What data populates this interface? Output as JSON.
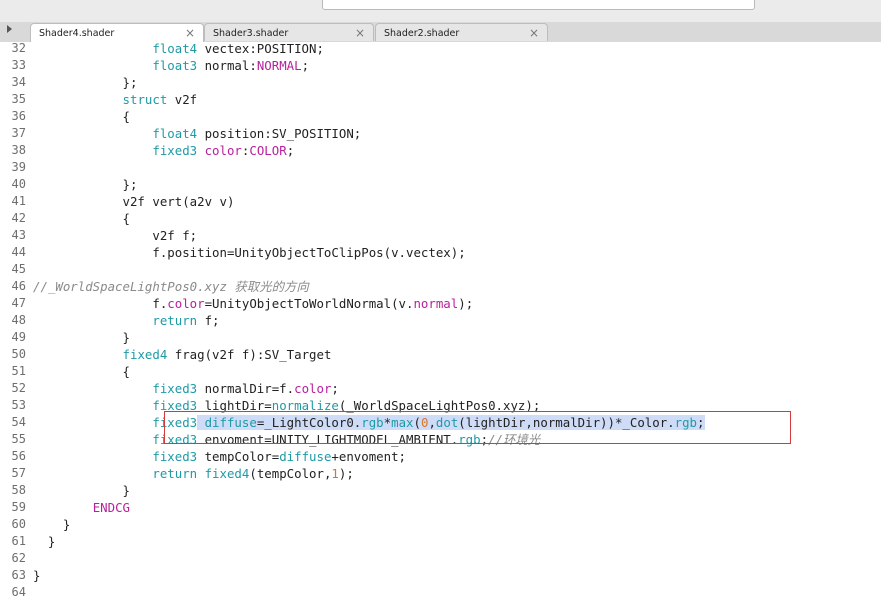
{
  "tabs": [
    {
      "label": "Shader4.shader",
      "close": "×",
      "active": true
    },
    {
      "label": "Shader3.shader",
      "close": "×",
      "active": false
    },
    {
      "label": "Shader2.shader",
      "close": "×",
      "active": false
    }
  ],
  "lines": [
    {
      "n": "32",
      "t": [
        {
          "s": "                float4 ",
          "c": "kw"
        },
        {
          "s": "vectex:",
          "c": ""
        },
        {
          "s": "POSITION",
          "c": ""
        },
        {
          "s": ";",
          "c": ""
        }
      ]
    },
    {
      "n": "33",
      "t": [
        {
          "s": "                ",
          "c": ""
        },
        {
          "s": "float3",
          "c": "kw"
        },
        {
          "s": " normal:",
          "c": ""
        },
        {
          "s": "NORMAL",
          "c": "sem"
        },
        {
          "s": ";",
          "c": ""
        }
      ]
    },
    {
      "n": "34",
      "t": [
        {
          "s": "            };",
          "c": ""
        }
      ]
    },
    {
      "n": "35",
      "t": [
        {
          "s": "            ",
          "c": ""
        },
        {
          "s": "struct",
          "c": "kw"
        },
        {
          "s": " v2f",
          "c": ""
        }
      ]
    },
    {
      "n": "36",
      "t": [
        {
          "s": "            {",
          "c": ""
        }
      ]
    },
    {
      "n": "37",
      "t": [
        {
          "s": "                ",
          "c": ""
        },
        {
          "s": "float4",
          "c": "kw"
        },
        {
          "s": " position:SV_POSITION;",
          "c": ""
        }
      ]
    },
    {
      "n": "38",
      "t": [
        {
          "s": "                ",
          "c": ""
        },
        {
          "s": "fixed3",
          "c": "kw"
        },
        {
          "s": " ",
          "c": ""
        },
        {
          "s": "color",
          "c": "sem"
        },
        {
          "s": ":",
          "c": ""
        },
        {
          "s": "COLOR",
          "c": "sem"
        },
        {
          "s": ";",
          "c": ""
        }
      ]
    },
    {
      "n": "39",
      "t": [
        {
          "s": "",
          "c": ""
        }
      ]
    },
    {
      "n": "40",
      "t": [
        {
          "s": "            };",
          "c": ""
        }
      ]
    },
    {
      "n": "41",
      "t": [
        {
          "s": "            v2f vert(a2v v)",
          "c": ""
        }
      ]
    },
    {
      "n": "42",
      "t": [
        {
          "s": "            {",
          "c": ""
        }
      ]
    },
    {
      "n": "43",
      "t": [
        {
          "s": "                v2f f;",
          "c": ""
        }
      ]
    },
    {
      "n": "44",
      "t": [
        {
          "s": "                f.position=UnityObjectToClipPos(v.vectex);",
          "c": ""
        }
      ]
    },
    {
      "n": "45",
      "t": [
        {
          "s": "",
          "c": ""
        }
      ]
    },
    {
      "n": "46",
      "t": [
        {
          "s": "//_WorldSpaceLightPos0.xyz 获取光的方向",
          "c": "cm"
        }
      ],
      "nocode_indent": true
    },
    {
      "n": "47",
      "t": [
        {
          "s": "                f.",
          "c": ""
        },
        {
          "s": "color",
          "c": "sem"
        },
        {
          "s": "=UnityObjectToWorldNormal(v.",
          "c": ""
        },
        {
          "s": "normal",
          "c": "sem"
        },
        {
          "s": ");",
          "c": ""
        }
      ]
    },
    {
      "n": "48",
      "t": [
        {
          "s": "                ",
          "c": ""
        },
        {
          "s": "return",
          "c": "kw"
        },
        {
          "s": " f;",
          "c": ""
        }
      ]
    },
    {
      "n": "49",
      "t": [
        {
          "s": "            }",
          "c": ""
        }
      ]
    },
    {
      "n": "50",
      "t": [
        {
          "s": "            ",
          "c": ""
        },
        {
          "s": "fixed4",
          "c": "kw"
        },
        {
          "s": " frag(v2f f):SV_Target",
          "c": ""
        }
      ]
    },
    {
      "n": "51",
      "t": [
        {
          "s": "            {",
          "c": ""
        }
      ]
    },
    {
      "n": "52",
      "t": [
        {
          "s": "                ",
          "c": ""
        },
        {
          "s": "fixed3",
          "c": "kw"
        },
        {
          "s": " normalDir=f.",
          "c": ""
        },
        {
          "s": "color",
          "c": "sem"
        },
        {
          "s": ";",
          "c": ""
        }
      ]
    },
    {
      "n": "53",
      "t": [
        {
          "s": "                ",
          "c": ""
        },
        {
          "s": "fixed3",
          "c": "kw"
        },
        {
          "s": " lightDir=",
          "c": ""
        },
        {
          "s": "normalize",
          "c": "fn"
        },
        {
          "s": "(_WorldSpaceLightPos0.xyz);",
          "c": ""
        }
      ]
    },
    {
      "n": "54",
      "t": [
        {
          "s": "                ",
          "c": ""
        },
        {
          "s": "fixed3",
          "c": "kw"
        },
        {
          "s": " ",
          "c": "sel"
        },
        {
          "s": "diffuse",
          "c": "sel kw"
        },
        {
          "s": "=_LightColor0.",
          "c": "sel"
        },
        {
          "s": "rgb",
          "c": "sel kw"
        },
        {
          "s": "*",
          "c": "sel"
        },
        {
          "s": "max",
          "c": "sel fn"
        },
        {
          "s": "(",
          "c": "sel"
        },
        {
          "s": "0",
          "c": "sel num"
        },
        {
          "s": ",",
          "c": "sel"
        },
        {
          "s": "dot",
          "c": "sel fn"
        },
        {
          "s": "(lightDir,normalDir))*_Color.",
          "c": "sel"
        },
        {
          "s": "rgb",
          "c": "sel kw"
        },
        {
          "s": ";",
          "c": "sel"
        }
      ]
    },
    {
      "n": "55",
      "t": [
        {
          "s": "                ",
          "c": ""
        },
        {
          "s": "fixed3",
          "c": "kw"
        },
        {
          "s": " envoment=UNITY_LIGHTMODEL_AMBIENT.",
          "c": ""
        },
        {
          "s": "rgb",
          "c": "kw"
        },
        {
          "s": ";",
          "c": ""
        },
        {
          "s": "//环境光",
          "c": "cm"
        }
      ]
    },
    {
      "n": "56",
      "t": [
        {
          "s": "                ",
          "c": ""
        },
        {
          "s": "fixed3",
          "c": "kw"
        },
        {
          "s": " tempColor=",
          "c": ""
        },
        {
          "s": "diffuse",
          "c": "kw"
        },
        {
          "s": "+envoment;",
          "c": ""
        }
      ]
    },
    {
      "n": "57",
      "t": [
        {
          "s": "                ",
          "c": ""
        },
        {
          "s": "return",
          "c": "kw"
        },
        {
          "s": " ",
          "c": ""
        },
        {
          "s": "fixed4",
          "c": "kw"
        },
        {
          "s": "(tempColor,",
          "c": ""
        },
        {
          "s": "1",
          "c": "num"
        },
        {
          "s": ");",
          "c": ""
        }
      ]
    },
    {
      "n": "58",
      "t": [
        {
          "s": "            }",
          "c": ""
        }
      ]
    },
    {
      "n": "59",
      "t": [
        {
          "s": "        ",
          "c": ""
        },
        {
          "s": "ENDCG",
          "c": "sem"
        }
      ]
    },
    {
      "n": "60",
      "t": [
        {
          "s": "    }",
          "c": ""
        }
      ]
    },
    {
      "n": "61",
      "t": [
        {
          "s": "  }",
          "c": ""
        }
      ]
    },
    {
      "n": "62",
      "t": [
        {
          "s": "",
          "c": ""
        }
      ]
    },
    {
      "n": "63",
      "t": [
        {
          "s": "}",
          "c": ""
        }
      ]
    },
    {
      "n": "64",
      "t": [
        {
          "s": "",
          "c": ""
        }
      ]
    }
  ]
}
